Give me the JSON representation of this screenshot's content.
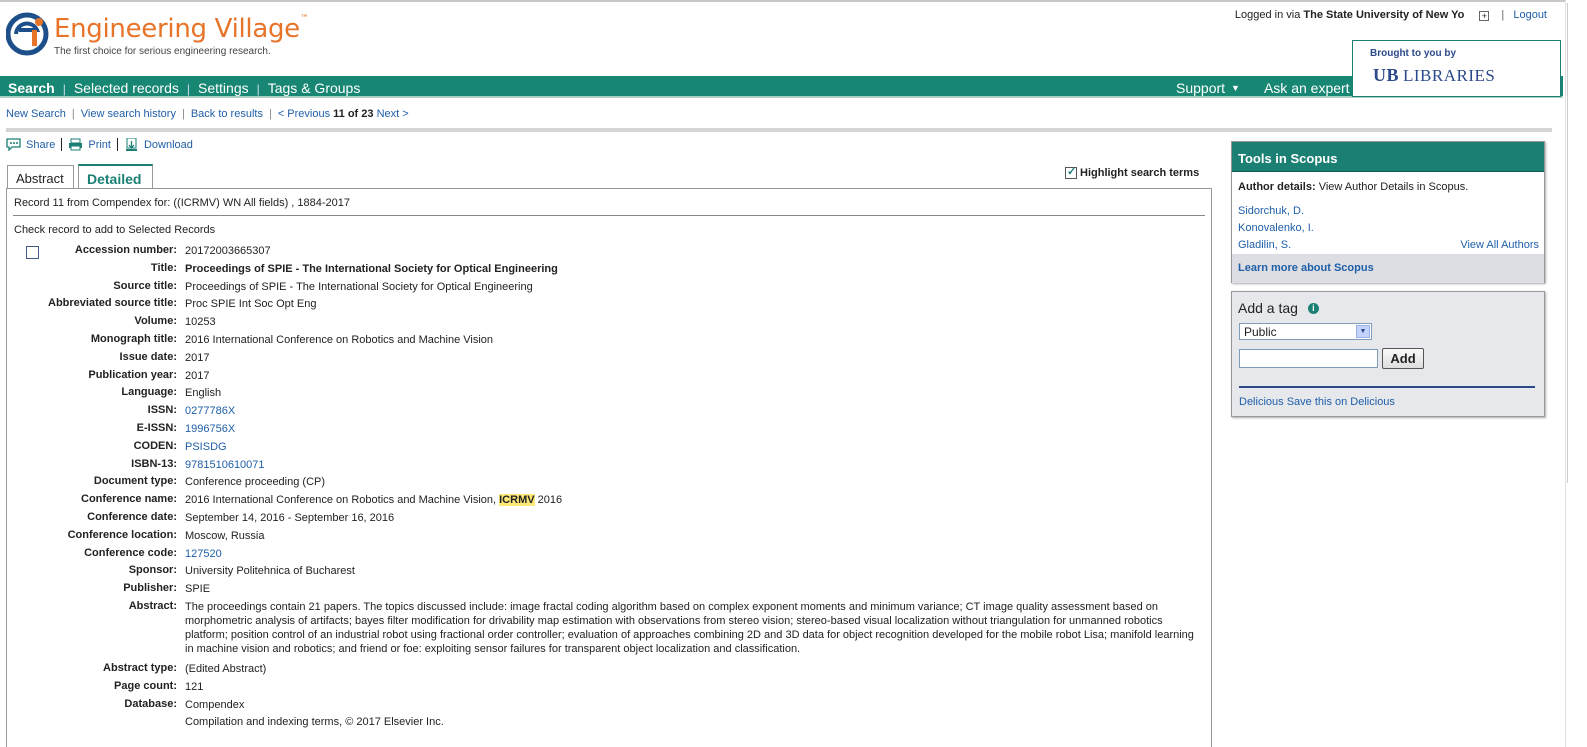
{
  "header": {
    "logo_title": "Engineering Village",
    "logo_tm": "™",
    "logo_tagline": "The first choice for serious engineering research.",
    "login_prefix": "Logged in via",
    "login_institution": "The State University of New Yo",
    "logout": "Logout",
    "brought_to_you": "Brought to you by",
    "libraries_mark": "UB",
    "libraries_name": "LIBRARIES"
  },
  "nav": {
    "left": [
      "Search",
      "Selected records",
      "Settings",
      "Tags & Groups"
    ],
    "support": "Support",
    "ask": "Ask an expert"
  },
  "subnav": {
    "new_search": "New Search",
    "history": "View search history",
    "back": "Back to results",
    "previous": "< Previous",
    "position": "11 of 23",
    "next": "Next >"
  },
  "actions": {
    "share": "Share",
    "print": "Print",
    "download": "Download"
  },
  "tabs": {
    "abstract": "Abstract",
    "detailed": "Detailed"
  },
  "highlight": {
    "label": "Highlight search terms",
    "checked": true
  },
  "record": {
    "from": "Record 11 from Compendex for: ((ICRMV) WN All fields) , 1884-2017",
    "check_note": "Check record to add to Selected Records",
    "fields": [
      {
        "label": "Accession number:",
        "value": "20172003665307"
      },
      {
        "label": "Title:",
        "value": "Proceedings of SPIE - The International Society for Optical Engineering"
      },
      {
        "label": "Source title:",
        "value": "Proceedings of SPIE - The International Society for Optical Engineering"
      },
      {
        "label": "Abbreviated source title:",
        "value": "Proc SPIE Int Soc Opt Eng"
      },
      {
        "label": "Volume:",
        "value": "10253"
      },
      {
        "label": "Monograph title:",
        "value": "2016 International Conference on Robotics and Machine Vision"
      },
      {
        "label": "Issue date:",
        "value": "2017"
      },
      {
        "label": "Publication year:",
        "value": "2017"
      },
      {
        "label": "Language:",
        "value": "English"
      },
      {
        "label": "ISSN:",
        "value": "0277786X"
      },
      {
        "label": "E-ISSN:",
        "value": "1996756X"
      },
      {
        "label": "CODEN:",
        "value": "PSISDG"
      },
      {
        "label": "ISBN-13:",
        "value": "9781510610071"
      },
      {
        "label": "Document type:",
        "value": "Conference proceeding (CP)"
      },
      {
        "label": "Conference name:",
        "value_pre": "2016 International Conference on Robotics and Machine Vision, ",
        "value_hl": "ICRMV",
        "value_post": " 2016"
      },
      {
        "label": "Conference date:",
        "value": "September 14, 2016 - September 16, 2016"
      },
      {
        "label": "Conference location:",
        "value": "Moscow, Russia"
      },
      {
        "label": "Conference code:",
        "value": "127520"
      },
      {
        "label": "Sponsor:",
        "value": "University Politehnica of Bucharest"
      },
      {
        "label": "Publisher:",
        "value": "SPIE"
      },
      {
        "label": "Abstract:",
        "value": "The proceedings contain 21 papers. The topics discussed include: image fractal coding algorithm based on complex exponent moments and minimum variance; CT image quality assessment based on morphometric analysis of artifacts; bayes filter modification for drivability map estimation with observations from stereo vision; stereo-based visual localization without triangulation for unmanned robotics platform; position control of an industrial robot using fractional order controller; evaluation of approaches combining 2D and 3D data for object recognition developed for the mobile robot Lisa; manifold learning in machine vision and robotics; and friend or foe: exploiting sensor failures for transparent object localization and classification."
      },
      {
        "label": "Abstract type:",
        "value": "(Edited Abstract)"
      },
      {
        "label": "Page count:",
        "value": "121"
      },
      {
        "label": "Database:",
        "value": "Compendex"
      },
      {
        "label": "",
        "value": "Compilation and indexing terms, © 2017 Elsevier Inc."
      }
    ]
  },
  "scopus": {
    "title": "Tools in Scopus",
    "author_details_label": "Author details:",
    "author_details_text": "View Author Details in Scopus.",
    "authors": [
      "Sidorchuk, D.",
      "Konovalenko, I.",
      "Gladilin, S."
    ],
    "view_all": "View All Authors",
    "learn_more": "Learn more about Scopus"
  },
  "tag": {
    "title": "Add a tag",
    "info_icon": "i",
    "select_value": "Public",
    "input_placeholder": "",
    "add_button": "Add",
    "delicious_prefix": "Delicious",
    "delicious_link": "Save this on Delicious"
  },
  "colors": {
    "brand_teal": "#178672",
    "logo_orange": "#e8742a",
    "link_blue": "#1f5fa8",
    "highlight_yellow": "#ffe97a"
  }
}
